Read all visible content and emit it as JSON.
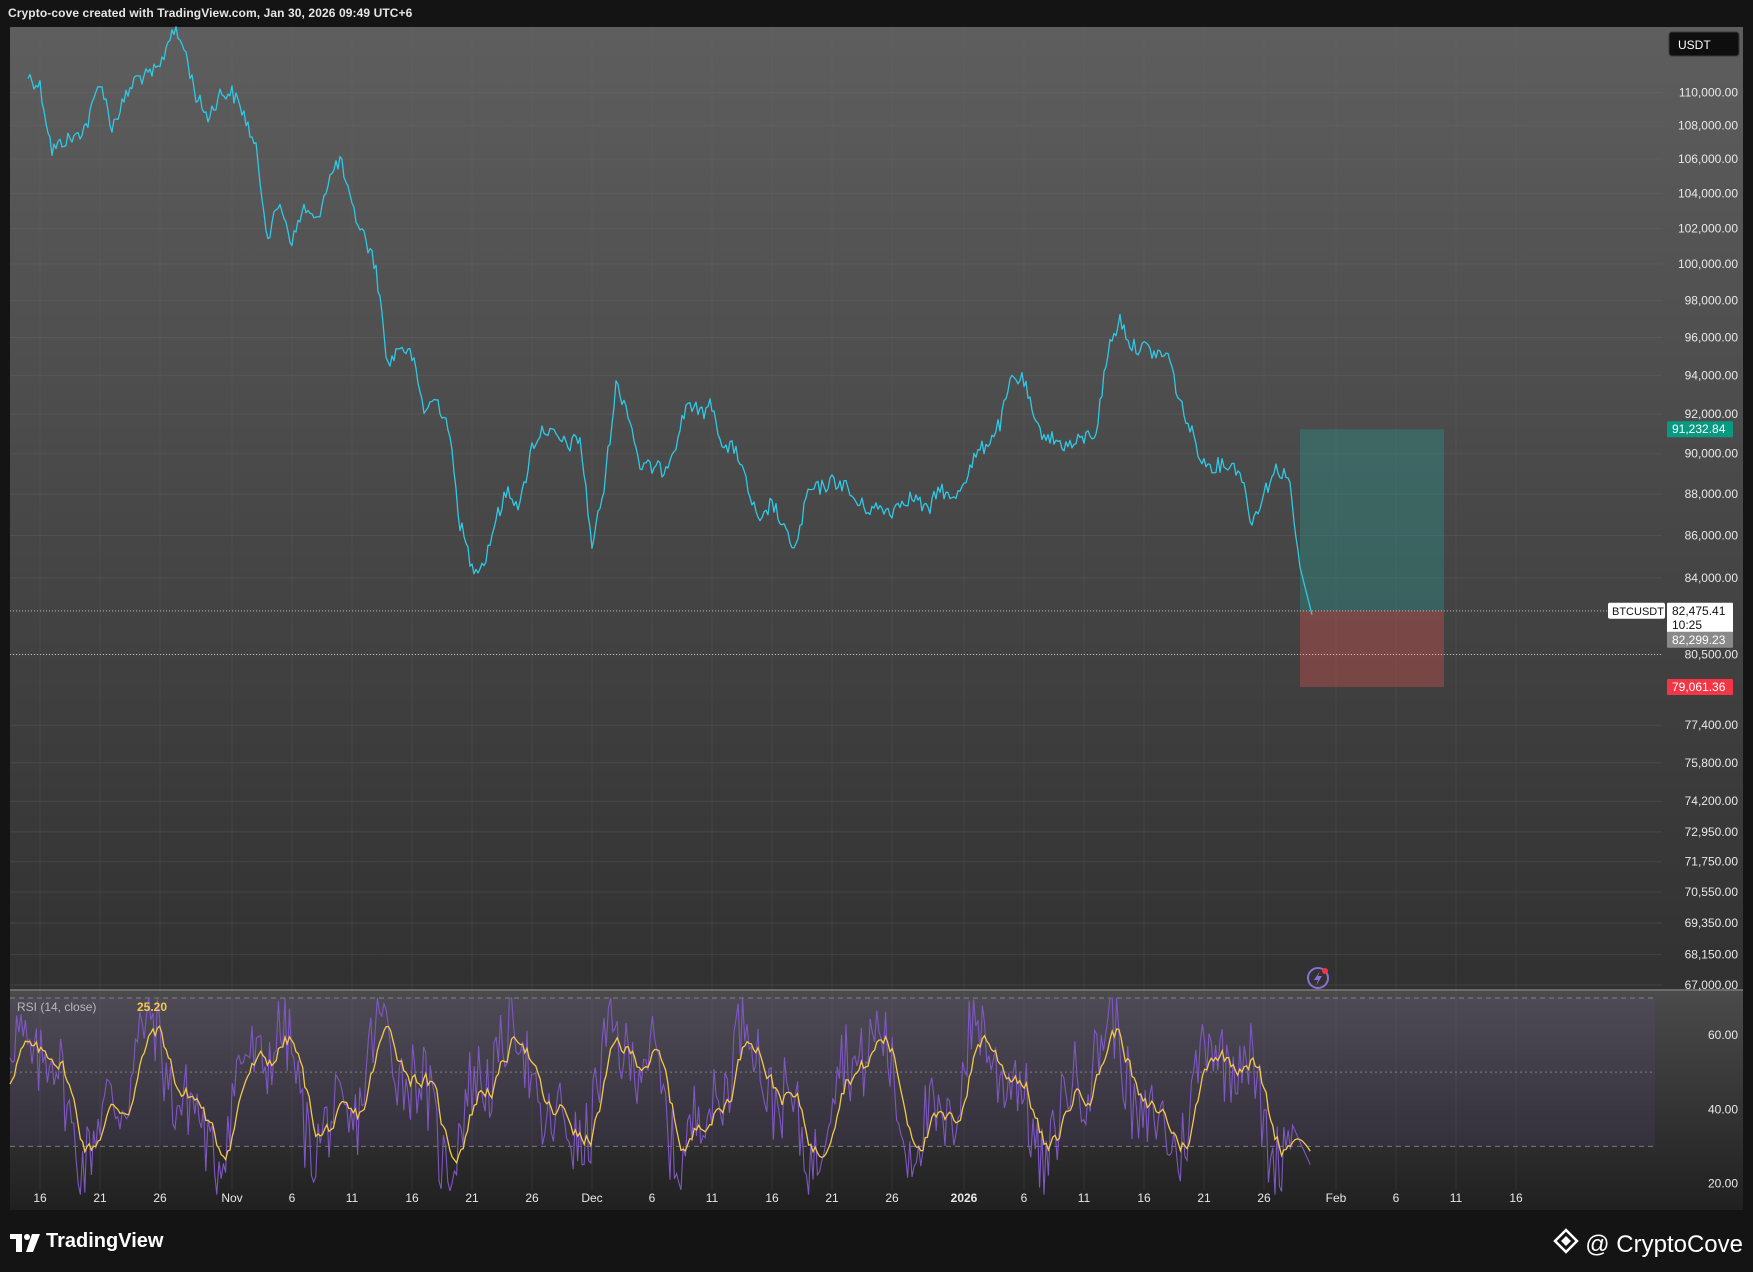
{
  "header": {
    "title": "Crypto-cove created with TradingView.com, Jan 30, 2026 09:49 UTC+6"
  },
  "footer": {
    "logo_text": "TradingView",
    "brand_text": "@ CryptoCove"
  },
  "colors": {
    "price_line": "#2ec9e6",
    "rsi_line": "#7e57c2",
    "rsi_ma": "#f3c84a",
    "target_zone": "#26a69a",
    "stop_zone": "#ef5350",
    "target_badge": "#089981",
    "stop_badge": "#f23645"
  },
  "chart_data": [
    {
      "type": "line",
      "symbol": "BTCUSDT",
      "currency": "USDT",
      "scale": "log",
      "ylim": [
        67000,
        112000
      ],
      "y_ticks": [
        "110,000.00",
        "108,000.00",
        "106,000.00",
        "104,000.00",
        "102,000.00",
        "100,000.00",
        "98,000.00",
        "96,000.00",
        "94,000.00",
        "92,000.00",
        "90,000.00",
        "88,000.00",
        "86,000.00",
        "84,000.00",
        "80,500.00",
        "77,400.00",
        "75,800.00",
        "74,200.00",
        "72,950.00",
        "71,750.00",
        "70,550.00",
        "69,350.00",
        "68,150.00",
        "67,000.00"
      ],
      "x_ticks": [
        "16",
        "21",
        "26",
        "Nov",
        "6",
        "11",
        "16",
        "21",
        "26",
        "Dec",
        "6",
        "11",
        "16",
        "21",
        "26",
        "2026",
        "6",
        "11",
        "16",
        "21",
        "26",
        "Feb",
        "6",
        "11",
        "16"
      ],
      "x_dates": [
        "2025-10-16",
        "2025-10-21",
        "2025-10-26",
        "2025-11-01",
        "2025-11-06",
        "2025-11-11",
        "2025-11-16",
        "2025-11-21",
        "2025-11-26",
        "2025-12-01",
        "2025-12-06",
        "2025-12-11",
        "2025-12-16",
        "2025-12-21",
        "2025-12-26",
        "2026-01-01",
        "2026-01-06",
        "2026-01-11",
        "2026-01-16",
        "2026-01-21",
        "2026-01-26",
        "2026-02-01",
        "2026-02-06",
        "2026-02-11",
        "2026-02-16"
      ],
      "series": [
        {
          "name": "BTCUSDT",
          "points": [
            [
              "2025-10-15",
              111000
            ],
            [
              "2025-10-16",
              110400
            ],
            [
              "2025-10-17",
              106500
            ],
            [
              "2025-10-18",
              107100
            ],
            [
              "2025-10-19",
              107300
            ],
            [
              "2025-10-20",
              108200
            ],
            [
              "2025-10-21",
              110800
            ],
            [
              "2025-10-22",
              107900
            ],
            [
              "2025-10-23",
              109500
            ],
            [
              "2025-10-24",
              110900
            ],
            [
              "2025-10-25",
              111000
            ],
            [
              "2025-10-26",
              111500
            ],
            [
              "2025-10-27",
              114000
            ],
            [
              "2025-10-28",
              112800
            ],
            [
              "2025-10-29",
              109800
            ],
            [
              "2025-10-30",
              108500
            ],
            [
              "2025-10-31",
              109900
            ],
            [
              "2025-11-01",
              110000
            ],
            [
              "2025-11-02",
              108700
            ],
            [
              "2025-11-03",
              106500
            ],
            [
              "2025-11-04",
              101500
            ],
            [
              "2025-11-05",
              103500
            ],
            [
              "2025-11-06",
              101200
            ],
            [
              "2025-11-07",
              103200
            ],
            [
              "2025-11-08",
              102300
            ],
            [
              "2025-11-09",
              104700
            ],
            [
              "2025-11-10",
              106000
            ],
            [
              "2025-11-11",
              103100
            ],
            [
              "2025-11-12",
              101600
            ],
            [
              "2025-11-13",
              99800
            ],
            [
              "2025-11-14",
              94500
            ],
            [
              "2025-11-15",
              95600
            ],
            [
              "2025-11-16",
              95000
            ],
            [
              "2025-11-17",
              92200
            ],
            [
              "2025-11-18",
              92800
            ],
            [
              "2025-11-19",
              91500
            ],
            [
              "2025-11-20",
              86600
            ],
            [
              "2025-11-21",
              84500
            ],
            [
              "2025-11-22",
              84700
            ],
            [
              "2025-11-23",
              86800
            ],
            [
              "2025-11-24",
              88200
            ],
            [
              "2025-11-25",
              87400
            ],
            [
              "2025-11-26",
              90400
            ],
            [
              "2025-11-27",
              91300
            ],
            [
              "2025-11-28",
              90800
            ],
            [
              "2025-11-29",
              90400
            ],
            [
              "2025-11-30",
              90800
            ],
            [
              "2025-12-01",
              85500
            ],
            [
              "2025-12-02",
              88300
            ],
            [
              "2025-12-03",
              93500
            ],
            [
              "2025-12-04",
              92200
            ],
            [
              "2025-12-05",
              89400
            ],
            [
              "2025-12-06",
              89300
            ],
            [
              "2025-12-07",
              89200
            ],
            [
              "2025-12-08",
              90600
            ],
            [
              "2025-12-09",
              92700
            ],
            [
              "2025-12-10",
              92000
            ],
            [
              "2025-12-11",
              92500
            ],
            [
              "2025-12-12",
              90200
            ],
            [
              "2025-12-13",
              90300
            ],
            [
              "2025-12-14",
              88200
            ],
            [
              "2025-12-15",
              86400
            ],
            [
              "2025-12-16",
              87700
            ],
            [
              "2025-12-17",
              86200
            ],
            [
              "2025-12-18",
              85400
            ],
            [
              "2025-12-19",
              88100
            ],
            [
              "2025-12-20",
              88300
            ],
            [
              "2025-12-21",
              88600
            ],
            [
              "2025-12-22",
              88500
            ],
            [
              "2025-12-23",
              87600
            ],
            [
              "2025-12-24",
              87300
            ],
            [
              "2025-12-25",
              87300
            ],
            [
              "2025-12-26",
              87200
            ],
            [
              "2025-12-27",
              87800
            ],
            [
              "2025-12-28",
              87800
            ],
            [
              "2025-12-29",
              87100
            ],
            [
              "2025-12-30",
              88400
            ],
            [
              "2025-12-31",
              87600
            ],
            [
              "2026-01-01",
              88700
            ],
            [
              "2026-01-02",
              89900
            ],
            [
              "2026-01-03",
              90600
            ],
            [
              "2026-01-04",
              91500
            ],
            [
              "2026-01-05",
              93900
            ],
            [
              "2026-01-06",
              93700
            ],
            [
              "2026-01-07",
              91300
            ],
            [
              "2026-01-08",
              90900
            ],
            [
              "2026-01-09",
              90500
            ],
            [
              "2026-01-10",
              90400
            ],
            [
              "2026-01-11",
              90800
            ],
            [
              "2026-01-12",
              91100
            ],
            [
              "2026-01-13",
              95300
            ],
            [
              "2026-01-14",
              97000
            ],
            [
              "2026-01-15",
              95500
            ],
            [
              "2026-01-16",
              95500
            ],
            [
              "2026-01-17",
              95100
            ],
            [
              "2026-01-18",
              95100
            ],
            [
              "2026-01-19",
              92600
            ],
            [
              "2026-01-20",
              91000
            ],
            [
              "2026-01-21",
              89500
            ],
            [
              "2026-01-22",
              89400
            ],
            [
              "2026-01-23",
              89500
            ],
            [
              "2026-01-24",
              89200
            ],
            [
              "2026-01-25",
              86600
            ],
            [
              "2026-01-26",
              88100
            ],
            [
              "2026-01-27",
              89200
            ],
            [
              "2026-01-28",
              89000
            ],
            [
              "2026-01-29",
              84500
            ],
            [
              "2026-01-30",
              82299
            ]
          ]
        }
      ],
      "current_price": {
        "symbol": "BTCUSDT",
        "value": "82,475.41",
        "countdown": "10:25"
      },
      "labels": {
        "low_price": "82,299.23",
        "tp_price": "91,232.84",
        "sl_price": "79,061.36"
      },
      "position_tool": {
        "start": "2026-01-29",
        "end": "2026-02-10",
        "entry": 82480,
        "take_profit": 91232.84,
        "stop_loss": 79061.36
      },
      "dotted_levels": [
        82475.41,
        80500
      ]
    },
    {
      "type": "line",
      "title": "RSI (14, close)",
      "value_label": "25.20",
      "ylim": [
        15,
        70
      ],
      "y_ticks": [
        "60.00",
        "40.00",
        "20.00"
      ],
      "bands": [
        70,
        50,
        30
      ],
      "series": [
        {
          "name": "RSI"
        },
        {
          "name": "RSI-based MA"
        }
      ]
    }
  ]
}
